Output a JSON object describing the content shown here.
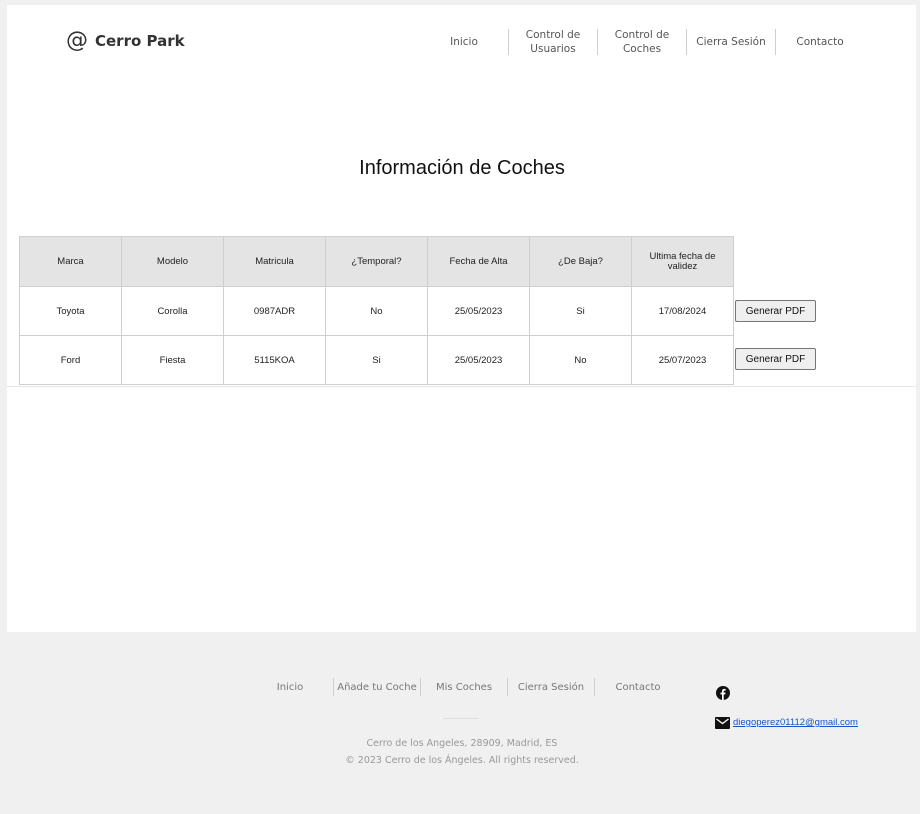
{
  "header": {
    "brand": {
      "icon": "at-sign-icon",
      "symbol": "@",
      "name": "Cerro Park"
    },
    "nav": [
      {
        "label": "Inicio"
      },
      {
        "label": "Control de\nUsuarios"
      },
      {
        "label": "Control de Coches"
      },
      {
        "label": "Cierra Sesión"
      },
      {
        "label": "Contacto"
      }
    ]
  },
  "main": {
    "title": "Información de Coches",
    "table": {
      "headers": [
        "Marca",
        "Modelo",
        "Matricula",
        "¿Temporal?",
        "Fecha de Alta",
        "¿De Baja?",
        "Ultima fecha de validez"
      ],
      "rows": [
        [
          "Toyota",
          "Corolla",
          "0987ADR",
          "No",
          "25/05/2023",
          "Si",
          "17/08/2024"
        ],
        [
          "Ford",
          "Fiesta",
          "5115KOA",
          "Si",
          "25/05/2023",
          "No",
          "25/07/2023"
        ]
      ],
      "row_button_label": "Generar PDF"
    }
  },
  "footer": {
    "nav": [
      {
        "label": "Inicio"
      },
      {
        "label": "Añade tu Coche"
      },
      {
        "label": "Mis Coches"
      },
      {
        "label": "Cierra Sesión"
      },
      {
        "label": "Contacto"
      }
    ],
    "address": "Cerro de los Angeles, 28909, Madrid, ES",
    "copyright": "© 2023 Cerro de los Ángeles.  All rights reserved.",
    "social_icon": "facebook-icon",
    "email_icon": "mail-icon",
    "email": "diegoperez01112@gmail.com"
  },
  "colors": {
    "page_bg": "#ffffff",
    "outer_bg": "#f0f0f0",
    "table_header_bg": "#e4e4e4",
    "link": "#1a53c7"
  }
}
